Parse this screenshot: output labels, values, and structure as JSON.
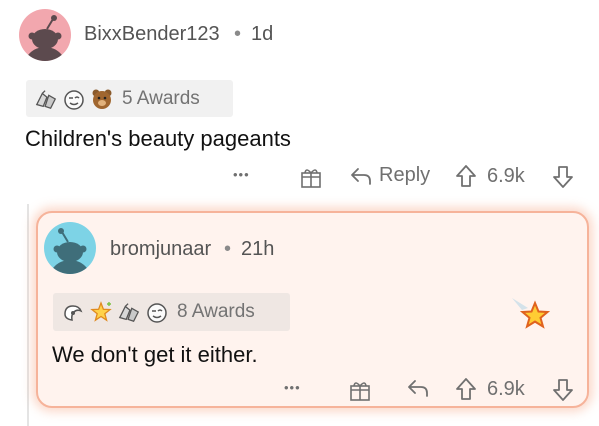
{
  "comment": {
    "username": "BixxBender123",
    "separator": "•",
    "age": "1d",
    "awards_label": "5 Awards",
    "award_icons": [
      "silver-hands-award-icon",
      "wink-face-award-icon",
      "bear-award-icon"
    ],
    "body": "Children's beauty pageants",
    "actions": {
      "more": "•••",
      "reply": "Reply",
      "score": "6.9k"
    }
  },
  "reply": {
    "username": "bromjunaar",
    "separator": "•",
    "age": "21h",
    "awards_label": "8 Awards",
    "award_icons": [
      "hug-award-icon",
      "sparkle-star-award-icon",
      "silver-hands-award-icon",
      "wink-face-award-icon"
    ],
    "body": "We don't get it either.",
    "highlight_award_icon": "star-award-icon",
    "actions": {
      "more": "•••",
      "score": "6.9k"
    }
  },
  "colors": {
    "reply_background": "#fff3ee",
    "reply_border": "#f6b39a",
    "avatar_1": "#f2a7ae",
    "avatar_2": "#7dd3e6"
  }
}
